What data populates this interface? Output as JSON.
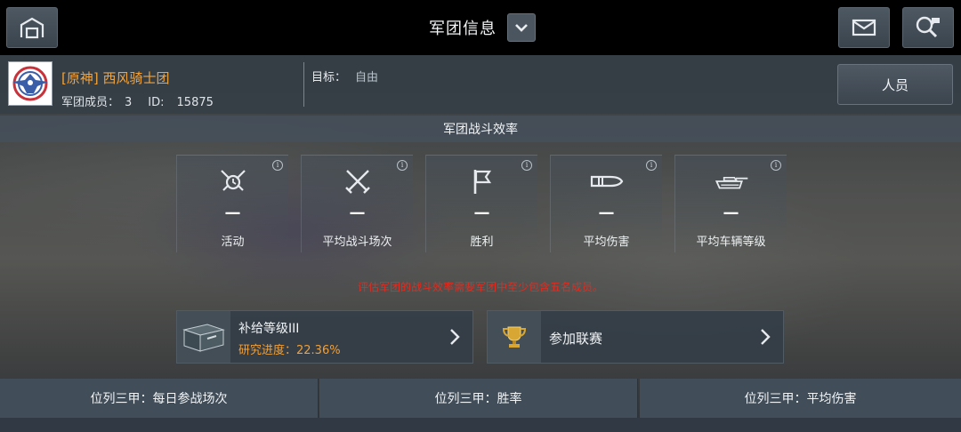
{
  "header": {
    "title": "军团信息"
  },
  "clan": {
    "name": "[原神] 西风骑士团",
    "members_label": "军团成员：",
    "members_count": "3",
    "id_label": "ID:",
    "id_value": "15875",
    "goal_label": "目标：",
    "goal_value": "自由",
    "members_button": "人员"
  },
  "efficiency": {
    "header": "军团战斗效率",
    "stats": [
      {
        "label": "活动",
        "value": "—",
        "icon": "alarm-swords-icon"
      },
      {
        "label": "平均战斗场次",
        "value": "—",
        "icon": "crossed-swords-icon"
      },
      {
        "label": "胜利",
        "value": "—",
        "icon": "flag-icon"
      },
      {
        "label": "平均伤害",
        "value": "—",
        "icon": "shell-icon"
      },
      {
        "label": "平均车辆等级",
        "value": "—",
        "icon": "tank-icon"
      }
    ],
    "info_glyph": "i",
    "warning": "评估军团的战斗效率需要军团中至少包含五名成员。"
  },
  "supply": {
    "title": "补给等级III",
    "progress": "研究进度：22.36%"
  },
  "league": {
    "title": "参加联赛"
  },
  "rankings": {
    "tabs": [
      "位列三甲：每日参战场次",
      "位列三甲：胜率",
      "位列三甲：平均伤害"
    ]
  },
  "colors": {
    "accent_orange": "#f2a33a",
    "warning_red": "#e62a1e"
  }
}
